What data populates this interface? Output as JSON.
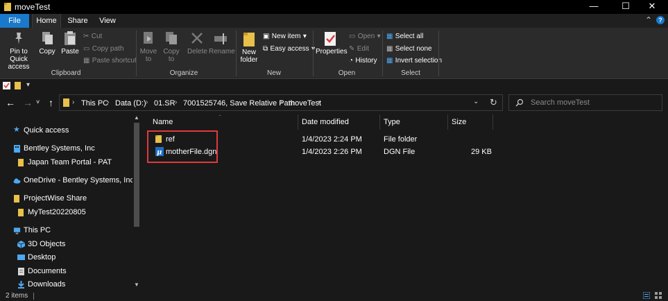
{
  "window": {
    "title": "moveTest",
    "minimize_glyph": "—",
    "maximize_glyph": "☐",
    "close_glyph": "✕"
  },
  "tabs": [
    {
      "label": "File"
    },
    {
      "label": "Home"
    },
    {
      "label": "Share"
    },
    {
      "label": "View"
    }
  ],
  "ribbon": {
    "clipboard": {
      "pin": "Pin to Quick access",
      "copy": "Copy",
      "paste": "Paste",
      "cut": "Cut",
      "copy_path": "Copy path",
      "paste_shortcut": "Paste shortcut",
      "group": "Clipboard"
    },
    "organize": {
      "move_to": "Move to",
      "copy_to": "Copy to",
      "delete": "Delete",
      "rename": "Rename",
      "group": "Organize"
    },
    "new": {
      "new_folder": "New folder",
      "new_item": "New item",
      "easy_access": "Easy access",
      "group": "New"
    },
    "open": {
      "properties": "Properties",
      "open": "Open",
      "edit": "Edit",
      "history": "History",
      "group": "Open"
    },
    "select": {
      "select_all": "Select all",
      "select_none": "Select none",
      "invert_selection": "Invert selection",
      "group": "Select"
    }
  },
  "address": {
    "crumbs": [
      "This PC",
      "Data (D:)",
      "01.SR",
      "7001525746, Save Relative Path",
      "moveTest"
    ],
    "search_placeholder": "Search moveTest"
  },
  "nav_pane": [
    {
      "label": "Quick access",
      "icon": "star-icon",
      "level": 0
    },
    {
      "label": "Bentley Systems, Inc",
      "icon": "building-icon",
      "level": 0
    },
    {
      "label": "Japan Team Portal - PAT",
      "icon": "folder-icon",
      "level": 1
    },
    {
      "label": "OneDrive - Bentley Systems, Inc",
      "icon": "cloud-icon",
      "level": 0
    },
    {
      "label": "ProjectWise Share",
      "icon": "folder-icon",
      "level": 0
    },
    {
      "label": "MyTest20220805",
      "icon": "folder-icon",
      "level": 1
    },
    {
      "label": "This PC",
      "icon": "computer-icon",
      "level": 0
    },
    {
      "label": "3D Objects",
      "icon": "cube-icon",
      "level": 1
    },
    {
      "label": "Desktop",
      "icon": "desktop-icon",
      "level": 1
    },
    {
      "label": "Documents",
      "icon": "document-icon",
      "level": 1
    },
    {
      "label": "Downloads",
      "icon": "download-icon",
      "level": 1
    }
  ],
  "columns": [
    "Name",
    "Date modified",
    "Type",
    "Size"
  ],
  "files": [
    {
      "name": "ref",
      "date": "1/4/2023 2:24 PM",
      "type": "File folder",
      "size": "",
      "icon": "folder-icon"
    },
    {
      "name": "motherFile.dgn",
      "date": "1/4/2023 2:26 PM",
      "type": "DGN File",
      "size": "29 KB",
      "icon": "microstation-icon"
    }
  ],
  "status": {
    "items": "2 items"
  },
  "colors": {
    "accent": "#1979ca",
    "highlight_box": "#e0393e",
    "folder": "#e8c04a"
  }
}
